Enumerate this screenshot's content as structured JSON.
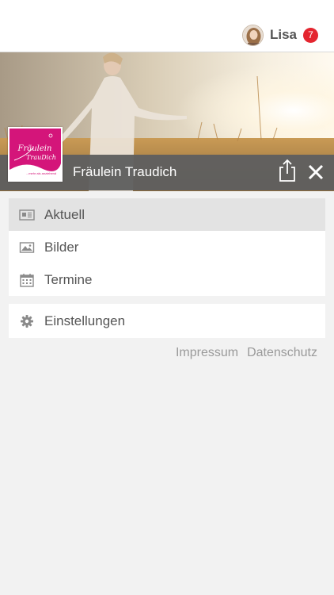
{
  "user": {
    "name": "Lisa",
    "notification_count": "7"
  },
  "page": {
    "name": "Fräulein Traudich"
  },
  "logo": {
    "text_line1": "Fräulein",
    "text_line2": "TrauDich",
    "tagline": "...mehr als anziehend"
  },
  "menu": {
    "items": [
      {
        "label": "Aktuell",
        "icon": "news-icon",
        "active": true
      },
      {
        "label": "Bilder",
        "icon": "image-icon",
        "active": false
      },
      {
        "label": "Termine",
        "icon": "calendar-icon",
        "active": false
      }
    ]
  },
  "settings": {
    "label": "Einstellungen",
    "icon": "gear-icon"
  },
  "footer_links": {
    "impressum": "Impressum",
    "datenschutz": "Datenschutz"
  },
  "colors": {
    "brand_pink": "#d4157a",
    "badge_red": "#e4252f",
    "titlebar": "#5f5f5f"
  }
}
